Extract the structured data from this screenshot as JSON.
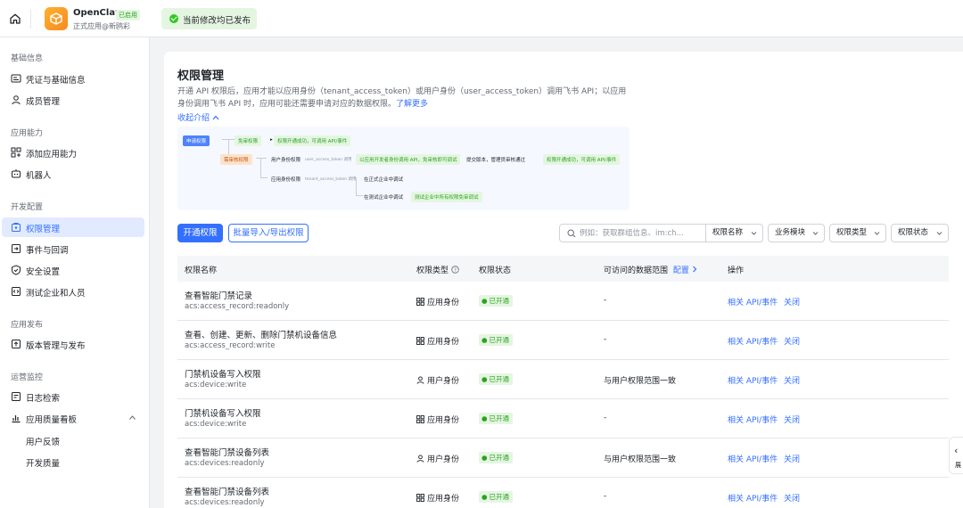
{
  "topbar": {
    "app_name": "OpenClaw",
    "app_badge": "已启用",
    "app_subtitle": "正式应用@新鸥彩",
    "toast": "当前修改均已发布"
  },
  "sidebar": {
    "sections": [
      {
        "label": "基础信息"
      },
      {
        "label": "应用能力"
      },
      {
        "label": "开发配置"
      },
      {
        "label": "应用发布"
      },
      {
        "label": "运营监控"
      }
    ],
    "items": [
      {
        "label": "凭证与基础信息",
        "icon": "credential-icon"
      },
      {
        "label": "成员管理",
        "icon": "user-icon"
      },
      {
        "label": "添加应用能力",
        "icon": "grid-add-icon"
      },
      {
        "label": "机器人",
        "icon": "robot-icon"
      },
      {
        "label": "权限管理",
        "icon": "permission-icon",
        "active": true
      },
      {
        "label": "事件与回调",
        "icon": "event-icon"
      },
      {
        "label": "安全设置",
        "icon": "shield-icon"
      },
      {
        "label": "测试企业和人员",
        "icon": "code-icon"
      },
      {
        "label": "版本管理与发布",
        "icon": "upload-icon"
      },
      {
        "label": "日志检索",
        "icon": "log-icon"
      },
      {
        "label": "应用质量看板",
        "icon": "chart-icon"
      }
    ],
    "subitems": [
      {
        "label": "用户反馈"
      },
      {
        "label": "开发质量"
      }
    ]
  },
  "main": {
    "title": "权限管理",
    "desc_text": "开通 API 权限后，应用才能以应用身份（tenant_access_token）或用户身份（user_access_token）调用飞书 API；以应用身份调用飞书 API 时，应用可能还需要申请对应的数据权限。",
    "desc_link": "了解更多",
    "collapse": "收起介绍",
    "flow": {
      "apply": "申请权限",
      "free": "免审权限",
      "free_result": "权限开通成功，可调用 API/事件",
      "review": "需审核权限",
      "user_perm": "用户身份权限",
      "user_token": "user_access_token 调用",
      "user_test": "以应用开发者身份调用 API，免审核即可调试",
      "submit": "提交版本，管理员审核通过",
      "success": "权限开通成功，可调用 API/事件",
      "tenant_perm": "应用身份权限",
      "tenant_token": "tenant_access_token 调用",
      "prod_debug": "在正式企业中调试",
      "test_debug": "在测试企业中调试",
      "test_result": "测试企业中所有权限免审调试"
    },
    "btn_open": "开通权限",
    "btn_import": "批量导入/导出权限",
    "search_placeholder": "例如：获取群组信息、im:ch...",
    "filters": {
      "name": "权限名称",
      "module": "业务模块",
      "type": "权限类型",
      "status": "权限状态"
    },
    "table": {
      "headers": {
        "name": "权限名称",
        "type": "权限类型",
        "status": "权限状态",
        "scope": "可访问的数据范围",
        "scope_link": "配置",
        "ops": "操作"
      },
      "rows": [
        {
          "name": "查看智能门禁记录",
          "code": "acs:access_record:readonly",
          "type": "应用身份",
          "type_icon": "app-icon",
          "status": "已开通",
          "scope": "-",
          "action1": "相关 API/事件",
          "action2": "关闭"
        },
        {
          "name": "查看、创建、更新、删除门禁机设备信息",
          "code": "acs:access_record:write",
          "type": "应用身份",
          "type_icon": "app-icon",
          "status": "已开通",
          "scope": "-",
          "action1": "相关 API/事件",
          "action2": "关闭"
        },
        {
          "name": "门禁机设备写入权限",
          "code": "acs:device:write",
          "type": "用户身份",
          "type_icon": "user-icon",
          "status": "已开通",
          "scope": "与用户权限范围一致",
          "action1": "相关 API/事件",
          "action2": "关闭"
        },
        {
          "name": "门禁机设备写入权限",
          "code": "acs:device:write",
          "type": "应用身份",
          "type_icon": "app-icon",
          "status": "已开通",
          "scope": "-",
          "action1": "相关 API/事件",
          "action2": "关闭"
        },
        {
          "name": "查看智能门禁设备列表",
          "code": "acs:devices:readonly",
          "type": "用户身份",
          "type_icon": "user-icon",
          "status": "已开通",
          "scope": "与用户权限范围一致",
          "action1": "相关 API/事件",
          "action2": "关闭"
        },
        {
          "name": "查看智能门禁设备列表",
          "code": "acs:devices:readonly",
          "type": "应用身份",
          "type_icon": "app-icon",
          "status": "已开通",
          "scope": "-",
          "action1": "相关 API/事件",
          "action2": "关闭"
        }
      ]
    },
    "side_tab": "展"
  }
}
